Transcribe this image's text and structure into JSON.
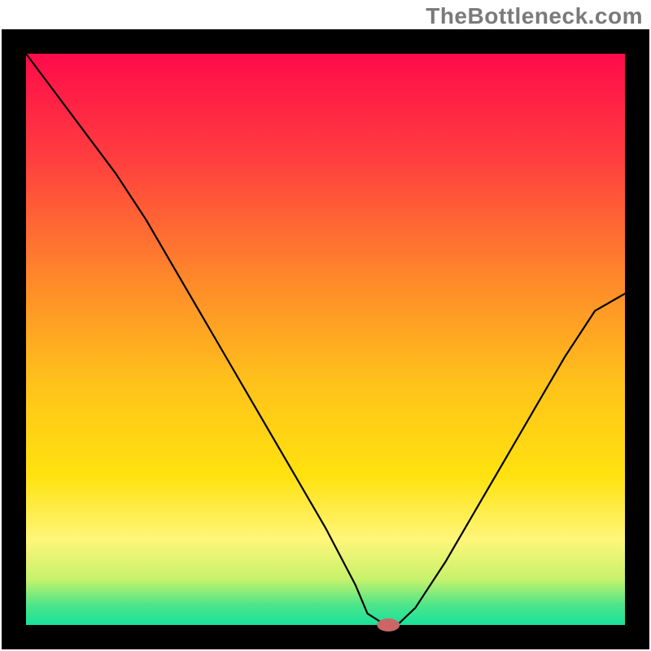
{
  "watermark": "TheBottleneck.com",
  "chart_data": {
    "type": "line",
    "title": "",
    "xlabel": "",
    "ylabel": "",
    "xlim": [
      0,
      100
    ],
    "ylim": [
      0,
      100
    ],
    "x": [
      0,
      5,
      10,
      15,
      20,
      25,
      30,
      35,
      40,
      45,
      50,
      55,
      57,
      60,
      62,
      65,
      70,
      75,
      80,
      85,
      90,
      95,
      100
    ],
    "values": [
      100,
      93,
      86,
      79,
      71,
      62,
      53,
      44,
      35,
      26,
      17,
      7,
      2,
      0,
      0,
      3,
      11,
      20,
      29,
      38,
      47,
      55,
      58
    ],
    "marker": {
      "x": 60.5,
      "y": 0
    },
    "gradient_stops": [
      {
        "offset": 0.0,
        "color": "#ff0b4a"
      },
      {
        "offset": 0.18,
        "color": "#ff3d3f"
      },
      {
        "offset": 0.4,
        "color": "#ff8a2a"
      },
      {
        "offset": 0.58,
        "color": "#ffc31a"
      },
      {
        "offset": 0.74,
        "color": "#ffe20f"
      },
      {
        "offset": 0.85,
        "color": "#fff67a"
      },
      {
        "offset": 0.92,
        "color": "#c6f26b"
      },
      {
        "offset": 0.965,
        "color": "#4de58a"
      },
      {
        "offset": 1.0,
        "color": "#17e29a"
      }
    ],
    "frame_color": "#000000",
    "line_color": "#000000",
    "line_width": 2.2,
    "marker_color": "#cc6666",
    "marker_rx": 14,
    "marker_ry": 8
  }
}
